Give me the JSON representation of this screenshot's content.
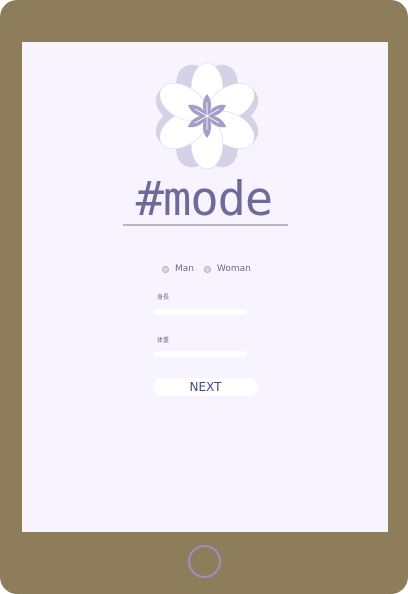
{
  "app": {
    "logo_text": "#mode"
  },
  "gender": {
    "options": [
      "Man",
      "Woman"
    ]
  },
  "form": {
    "height_label": "身長",
    "weight_label": "体重",
    "height_value": "",
    "weight_value": ""
  },
  "actions": {
    "next_label": "NEXT"
  },
  "colors": {
    "device_frame": "#8d7d5b",
    "screen_background": "#f7f3ff",
    "accent": "#6e6b98",
    "flower_outer_petals": "#d6d2e6",
    "flower_inner_petals": "#a39fcb",
    "home_button_ring": "#9b8fc6"
  },
  "icons": {
    "logo": "flower-icon",
    "home": "home-button-ring"
  }
}
